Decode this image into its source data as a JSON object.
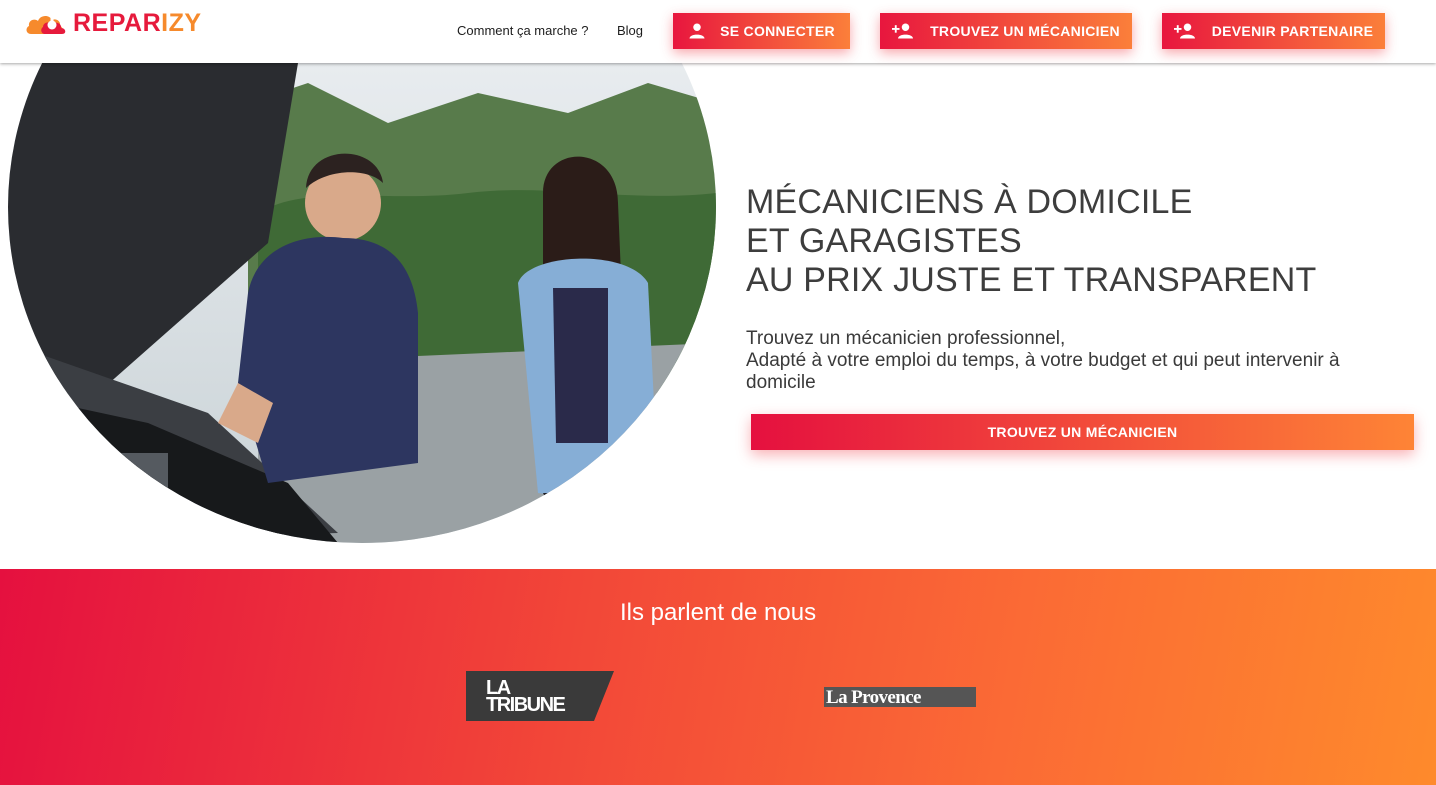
{
  "header": {
    "logo": {
      "part1": "REPAR",
      "part2": "IZY",
      "color1": "#e61a3c",
      "color2": "#f68a2c"
    },
    "nav_links": [
      "Comment ça marche ?",
      "Blog"
    ],
    "buttons": [
      {
        "label": "SE CONNECTER",
        "icon": "person-icon"
      },
      {
        "label": "TROUVEZ UN MÉCANICIEN",
        "icon": "person-add-icon"
      },
      {
        "label": "DEVENIR PARTENAIRE",
        "icon": "person-add-icon"
      }
    ]
  },
  "hero": {
    "headline": [
      "MÉCANICIENS À DOMICILE",
      "ET GARAGISTES",
      "AU PRIX JUSTE ET TRANSPARENT"
    ],
    "subtext": [
      "Trouvez un mécanicien professionnel,",
      "Adapté à votre emploi du temps, à votre budget et qui peut intervenir à domicile"
    ],
    "cta_label": "TROUVEZ UN MÉCANICIEN",
    "image": "mechanic-with-customer-photo"
  },
  "press": {
    "title": "Ils parlent de nous",
    "logos": [
      {
        "name": "la-tribune-logo",
        "text_line1": "LA",
        "text_line2": "TRIBUNE"
      },
      {
        "name": "la-provence-logo",
        "text": "La Provence"
      }
    ]
  },
  "colors": {
    "gradient_start": "#e5103f",
    "gradient_end": "#fe8a2c",
    "text_dark": "#3d3d3d"
  }
}
